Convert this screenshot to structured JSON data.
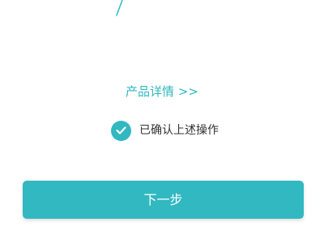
{
  "product_details": {
    "label": "产品详情 >>"
  },
  "confirmation": {
    "checked": true,
    "label": "已确认上述操作"
  },
  "next_button": {
    "label": "下一步"
  },
  "colors": {
    "accent": "#31b8c1",
    "text": "#333333",
    "background": "#ffffff"
  }
}
